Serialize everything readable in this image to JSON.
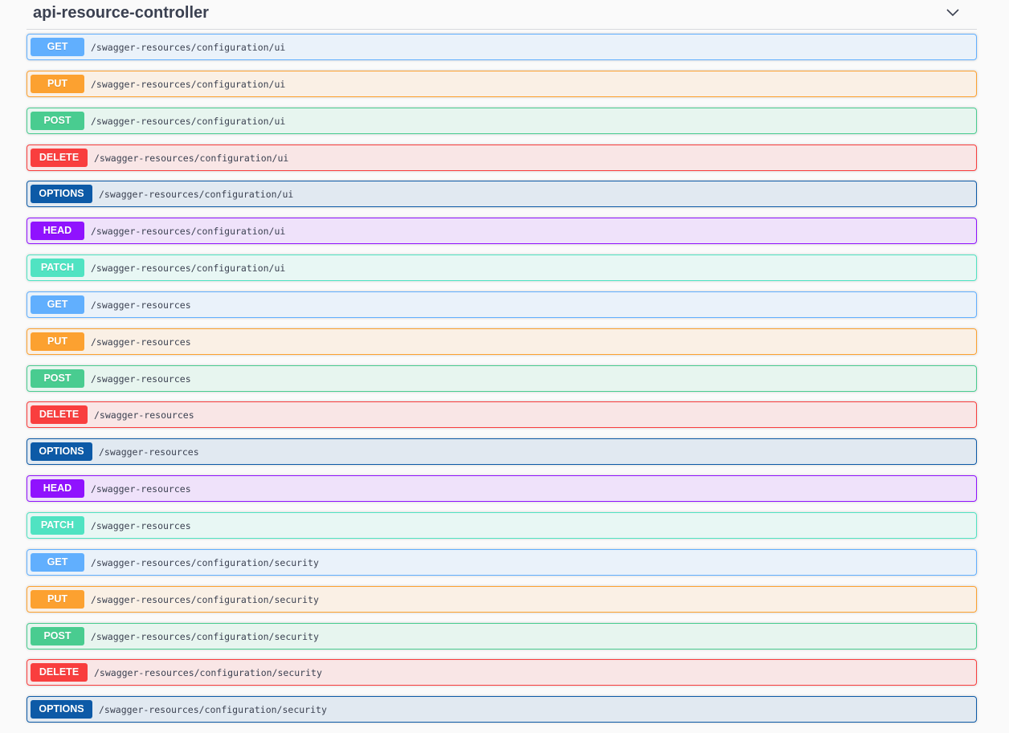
{
  "tag": {
    "title": "api-resource-controller",
    "toggle_icon": "chevron-down-icon"
  },
  "operations": [
    {
      "method": "GET",
      "path": "/swagger-resources/configuration/ui"
    },
    {
      "method": "PUT",
      "path": "/swagger-resources/configuration/ui"
    },
    {
      "method": "POST",
      "path": "/swagger-resources/configuration/ui"
    },
    {
      "method": "DELETE",
      "path": "/swagger-resources/configuration/ui"
    },
    {
      "method": "OPTIONS",
      "path": "/swagger-resources/configuration/ui"
    },
    {
      "method": "HEAD",
      "path": "/swagger-resources/configuration/ui"
    },
    {
      "method": "PATCH",
      "path": "/swagger-resources/configuration/ui"
    },
    {
      "method": "GET",
      "path": "/swagger-resources"
    },
    {
      "method": "PUT",
      "path": "/swagger-resources"
    },
    {
      "method": "POST",
      "path": "/swagger-resources"
    },
    {
      "method": "DELETE",
      "path": "/swagger-resources"
    },
    {
      "method": "OPTIONS",
      "path": "/swagger-resources"
    },
    {
      "method": "HEAD",
      "path": "/swagger-resources"
    },
    {
      "method": "PATCH",
      "path": "/swagger-resources"
    },
    {
      "method": "GET",
      "path": "/swagger-resources/configuration/security"
    },
    {
      "method": "PUT",
      "path": "/swagger-resources/configuration/security"
    },
    {
      "method": "POST",
      "path": "/swagger-resources/configuration/security"
    },
    {
      "method": "DELETE",
      "path": "/swagger-resources/configuration/security"
    },
    {
      "method": "OPTIONS",
      "path": "/swagger-resources/configuration/security"
    }
  ],
  "colors": {
    "GET": "#61affe",
    "PUT": "#fca130",
    "POST": "#49cc90",
    "DELETE": "#f93e3e",
    "OPTIONS": "#0d5aa7",
    "HEAD": "#9012fe",
    "PATCH": "#50e3c2"
  }
}
